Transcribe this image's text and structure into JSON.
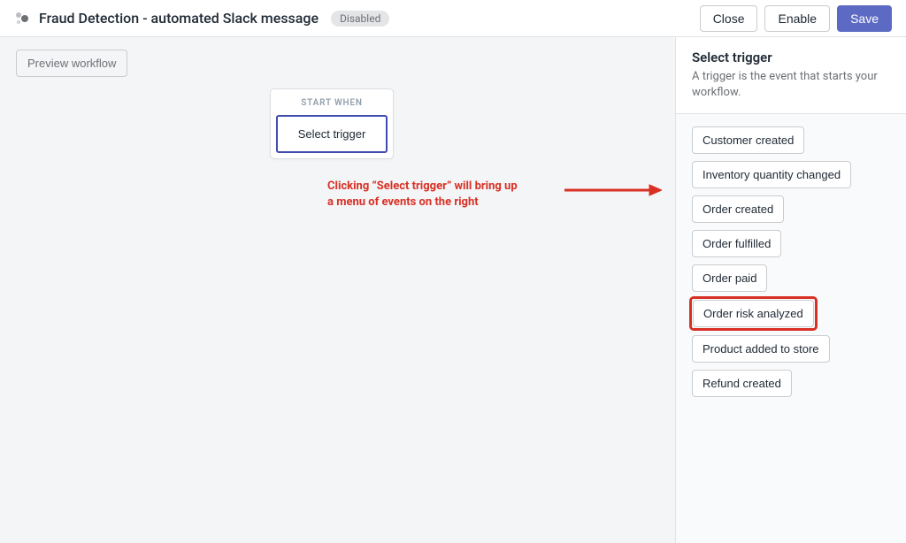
{
  "header": {
    "title": "Fraud Detection - automated Slack message",
    "status_label": "Disabled",
    "close_label": "Close",
    "enable_label": "Enable",
    "save_label": "Save"
  },
  "canvas": {
    "preview_label": "Preview workflow",
    "node": {
      "caption": "START WHEN",
      "trigger_label": "Select trigger"
    },
    "annotation_line1": "Clicking “Select trigger” will bring up",
    "annotation_line2": "a menu of events on the right"
  },
  "sidebar": {
    "title": "Select trigger",
    "subtitle": "A trigger is the event that starts your workflow.",
    "triggers": [
      {
        "label": "Customer created",
        "highlighted": false
      },
      {
        "label": "Inventory quantity changed",
        "highlighted": false
      },
      {
        "label": "Order created",
        "highlighted": false
      },
      {
        "label": "Order fulfilled",
        "highlighted": false
      },
      {
        "label": "Order paid",
        "highlighted": false
      },
      {
        "label": "Order risk analyzed",
        "highlighted": true
      },
      {
        "label": "Product added to store",
        "highlighted": false
      },
      {
        "label": "Refund created",
        "highlighted": false
      }
    ]
  }
}
